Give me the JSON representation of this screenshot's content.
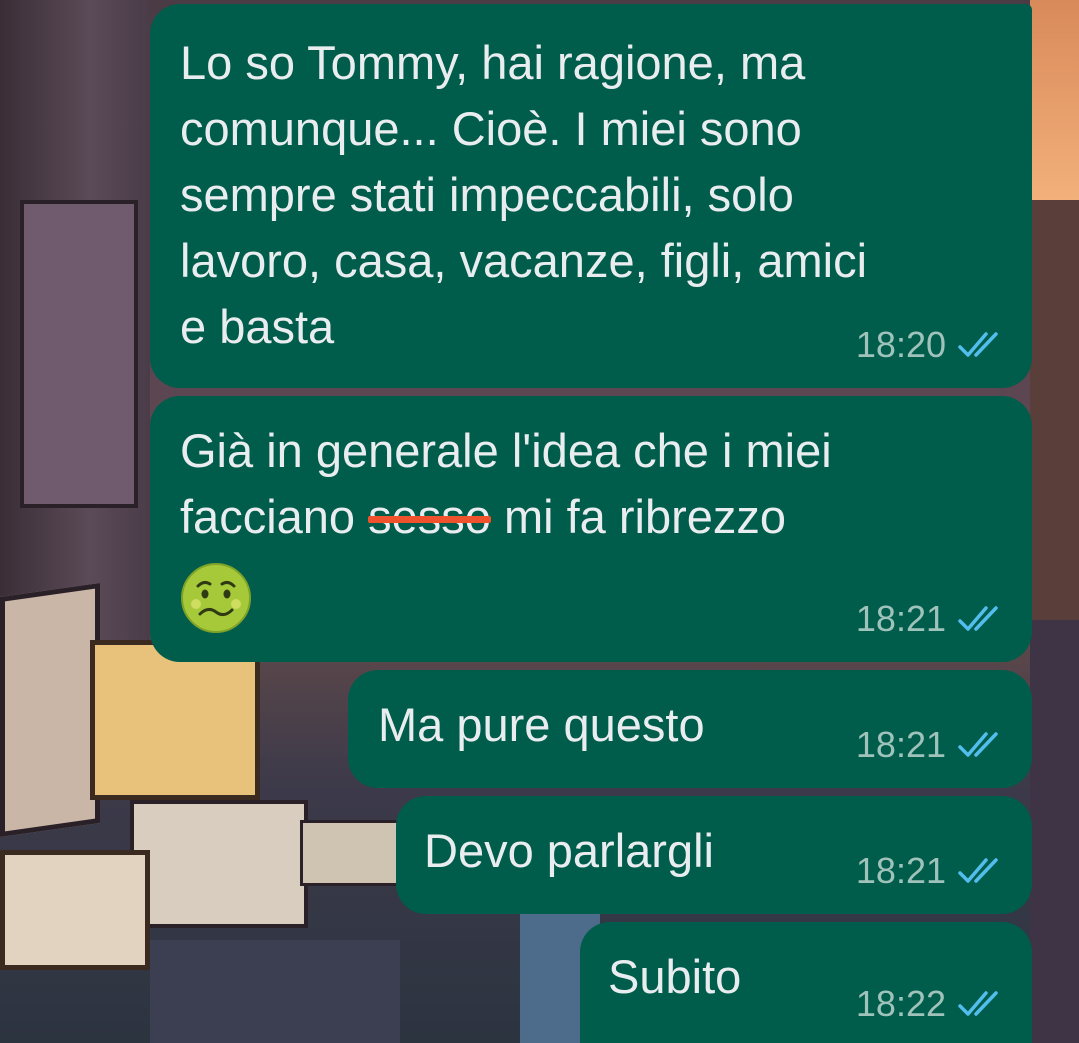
{
  "messages": [
    {
      "text": "Lo so Tommy, hai ragione, ma\ncomunque... Cioè. I miei sono\nsempre stati impeccabili, solo\nlavoro, casa, vacanze, figli, amici\ne basta",
      "time": "18:20",
      "status": "read"
    },
    {
      "text_before": "Già in generale l'idea che i miei\nfacciano ",
      "struck_word": "sesso",
      "text_after": " mi fa ribrezzo",
      "emoji": "nauseated-face",
      "time": "18:21",
      "status": "read"
    },
    {
      "text": "Ma pure questo",
      "time": "18:21",
      "status": "read"
    },
    {
      "text": "Devo parlargli",
      "time": "18:21",
      "status": "read"
    },
    {
      "text": "Subito",
      "time": "18:22",
      "status": "read"
    }
  ],
  "colors": {
    "outgoing_bubble": "#005c4b",
    "message_text": "#e9edef",
    "meta_text": "#9fc3bb",
    "read_ticks": "#53bdeb",
    "strike_line": "#f0522d"
  },
  "icons": {
    "read_receipt": "double-check-icon"
  }
}
